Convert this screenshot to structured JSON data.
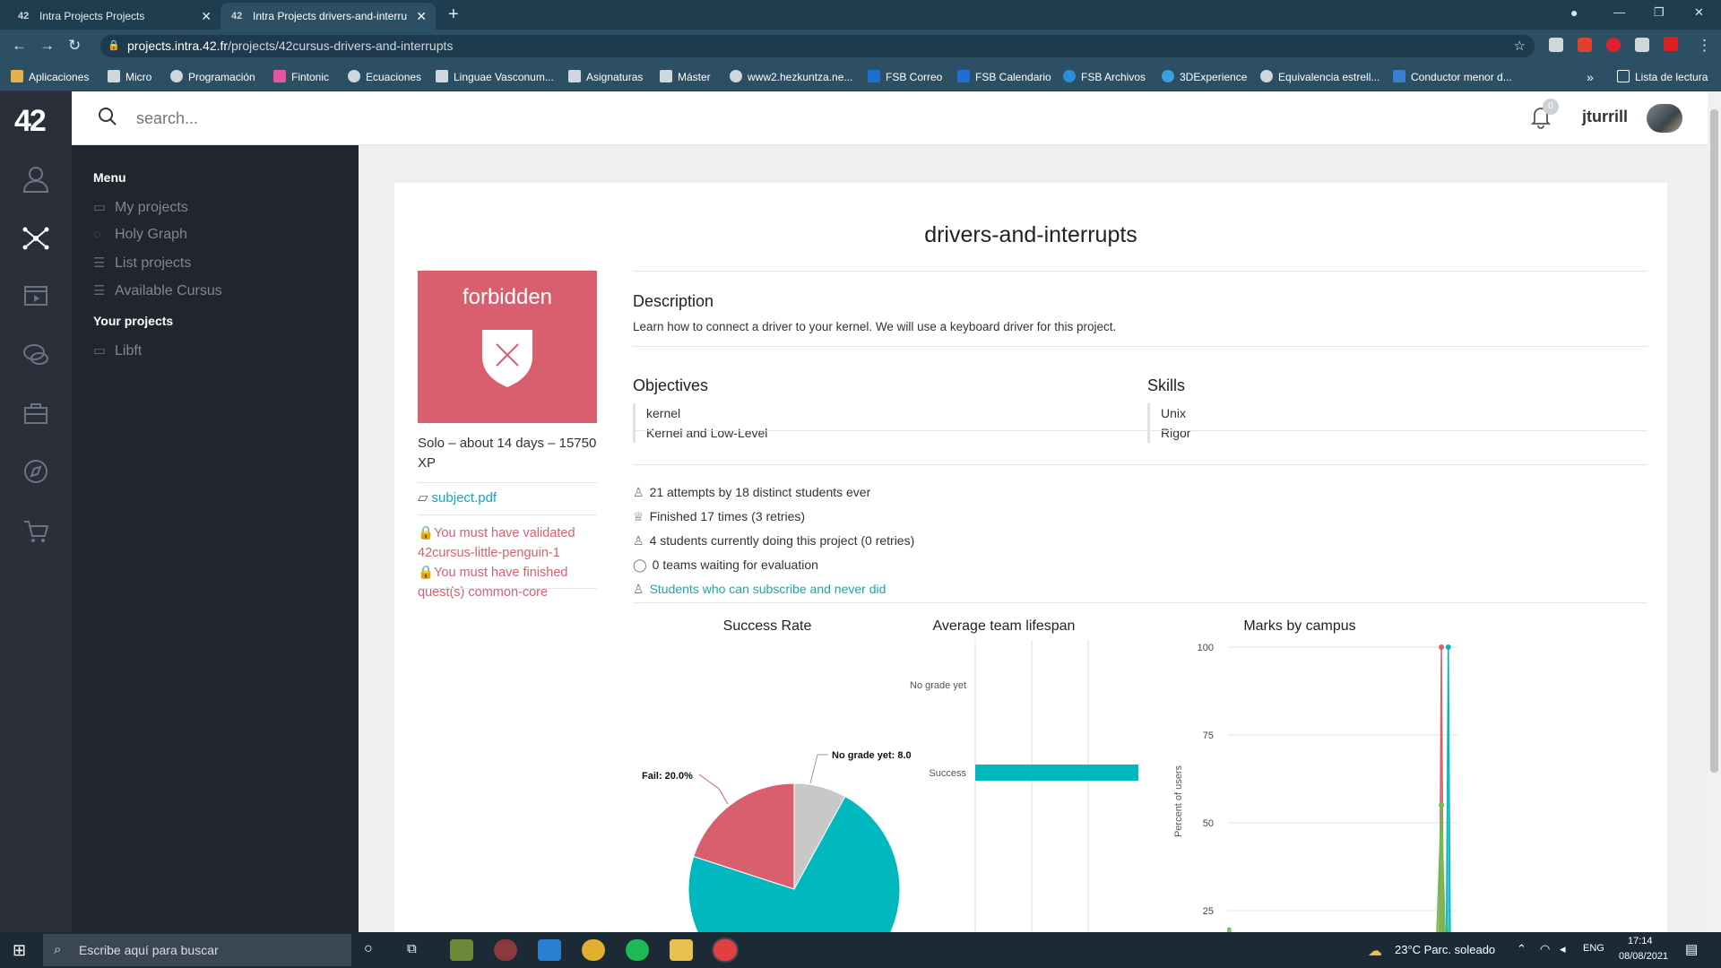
{
  "browser": {
    "tabs": [
      {
        "label": "Intra Projects Projects",
        "active": false
      },
      {
        "label": "Intra Projects drivers-and-interru",
        "active": true
      }
    ],
    "url_host": "projects.intra.42.fr",
    "url_path": "/projects/42cursus-drivers-and-interrupts",
    "bookmarks": [
      "Aplicaciones",
      "Micro",
      "Programación",
      "Fintonic",
      "Ecuaciones",
      "Linguae Vasconum...",
      "Asignaturas",
      "Máster",
      "www2.hezkuntza.ne...",
      "FSB Correo",
      "FSB Calendario",
      "FSB Archivos",
      "3DExperience",
      "Equivalencia estrell...",
      "Conductor menor d..."
    ],
    "reading_list": "Lista de lectura",
    "more_bookmarks": "»"
  },
  "site": {
    "logo": "42",
    "search_placeholder": "search...",
    "notifications_count": "0",
    "username": "jturrill"
  },
  "menu": {
    "menu_heading": "Menu",
    "items": [
      "My projects",
      "Holy Graph",
      "List projects",
      "Available Cursus"
    ],
    "your_projects_heading": "Your projects",
    "your_projects": [
      "Libft"
    ]
  },
  "project": {
    "title": "drivers-and-interrupts",
    "badge_label": "forbidden",
    "meta": "Solo – about 14 days – 15750 XP",
    "subject_link": "subject.pdf",
    "requirements": [
      "You must have validated 42cursus-little-penguin-1",
      "You must have finished quest(s) common-core"
    ],
    "description_heading": "Description",
    "description": "Learn how to connect a driver to your kernel. We will use a keyboard driver for this project.",
    "objectives_heading": "Objectives",
    "objectives": [
      "kernel",
      "Kernel and Low-Level"
    ],
    "skills_heading": "Skills",
    "skills": [
      "Unix",
      "Rigor"
    ],
    "stats": [
      "21 attempts by 18 distinct students ever",
      "Finished 17 times (3 retries)",
      "4 students currently doing this project (0 retries)",
      "0 teams waiting for evaluation"
    ],
    "students_link": "Students who can subscribe and never did"
  },
  "chart_data": [
    {
      "type": "pie",
      "title": "Success Rate",
      "slices": [
        {
          "label": "No grade yet",
          "value": 8.0,
          "color": "#c8c8c8"
        },
        {
          "label": "Success",
          "value": 72.0,
          "color": "#00b8bd"
        },
        {
          "label": "Fail",
          "value": 20.0,
          "color": "#d95f6f"
        }
      ],
      "data_labels": [
        "No grade yet: 8.0%",
        "Fail: 20.0%"
      ]
    },
    {
      "type": "bar",
      "title": "Average team lifespan",
      "categories": [
        "No grade yet",
        "Success"
      ],
      "values": [
        0,
        30
      ],
      "xlim": [
        0,
        40
      ],
      "color": "#00b8bd"
    },
    {
      "type": "area",
      "title": "Marks by campus",
      "ylabel": "Percent of users",
      "ylim": [
        0,
        100
      ],
      "yticks": [
        "100",
        "75",
        "50",
        "25"
      ],
      "series": [
        {
          "color": "#d95f6f",
          "points": [
            [
              0,
              0
            ],
            [
              92,
              0
            ],
            [
              93,
              100
            ],
            [
              94,
              0
            ],
            [
              100,
              0
            ]
          ]
        },
        {
          "color": "#00b8bd",
          "points": [
            [
              0,
              0
            ],
            [
              95,
              0
            ],
            [
              96,
              100
            ],
            [
              97,
              0
            ],
            [
              100,
              0
            ]
          ]
        },
        {
          "color": "#6cbf4a",
          "points": [
            [
              0,
              20
            ],
            [
              1,
              20
            ],
            [
              3,
              0
            ],
            [
              90,
              0
            ],
            [
              93,
              55
            ],
            [
              95,
              10
            ],
            [
              96,
              20
            ],
            [
              100,
              0
            ]
          ]
        }
      ]
    }
  ],
  "taskbar": {
    "search_placeholder": "Escribe aquí para buscar",
    "weather": "23°C  Parc. soleado",
    "lang": "ENG",
    "time": "17:14",
    "date": "08/08/2021"
  }
}
